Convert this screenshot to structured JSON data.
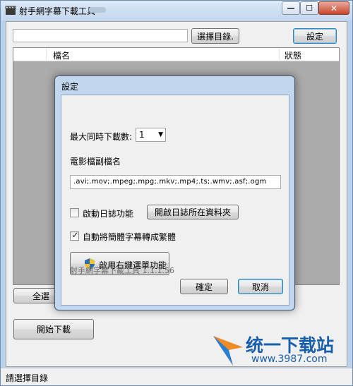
{
  "window": {
    "title": "射手網字幕下載工具",
    "minimize_label": "—",
    "maximize_label": "☐",
    "close_label": "✕"
  },
  "toolbar": {
    "path_value": "",
    "browse_label": "選擇目錄.",
    "settings_label": "設定"
  },
  "list": {
    "columns": [
      "檔名",
      "狀態"
    ]
  },
  "actions": {
    "select_all_label": "全選",
    "start_label": "開始下載"
  },
  "statusbar": {
    "text": "請選擇目錄"
  },
  "dialog": {
    "title": "設定",
    "max_downloads_label": "最大同時下載數:",
    "max_downloads_value": "1",
    "ext_label": "電影檔副檔名",
    "ext_value": ".avi;.mov;.mpeg;.mpg;.mkv;.mp4;.ts;.wmv;.asf;.ogm",
    "log_checkbox_label": "啟動日誌功能",
    "log_checked": false,
    "open_log_folder_label": "開啟日誌所在資料夾",
    "convert_checkbox_label": "自動將簡體字幕轉成繁體",
    "convert_checked": true,
    "context_menu_label": "啟用右鍵選單功能",
    "version_text": "射手網字幕下載工具 1.1.1.56",
    "ok_label": "確定",
    "cancel_label": "取消"
  },
  "watermark": {
    "brand": "统一下载站",
    "url": "www.3987.com"
  },
  "colors": {
    "accent_blue": "#3c7fb1",
    "watermark_blue": "#1a5fae",
    "list_bg": "#ababab"
  }
}
